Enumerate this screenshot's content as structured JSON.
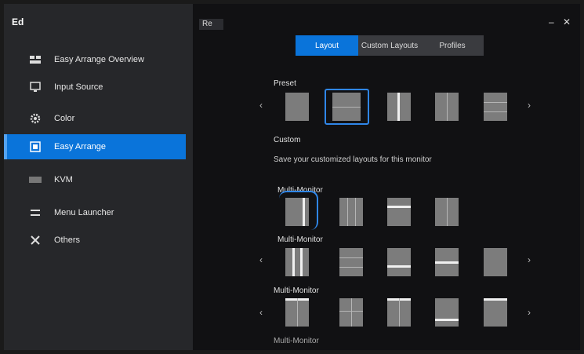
{
  "app": {
    "title": "Ed"
  },
  "window": {
    "minimize": "–",
    "close": "✕"
  },
  "header": {
    "badge": "Re"
  },
  "sidebar": {
    "items": [
      {
        "label": "Easy Arrange Overview",
        "icon": "grid-icon",
        "active": false
      },
      {
        "label": "Input Source",
        "icon": "monitor-icon",
        "active": false
      },
      {
        "label": "Color",
        "icon": "gear-icon",
        "active": false
      },
      {
        "label": "Easy Arrange",
        "icon": "layout-icon",
        "active": true
      },
      {
        "label": "KVM",
        "icon": "keyboard-icon",
        "active": false
      },
      {
        "label": "Menu Launcher",
        "icon": "menu-icon",
        "active": false
      },
      {
        "label": "Others",
        "icon": "tools-icon",
        "active": false
      }
    ]
  },
  "tabs": [
    {
      "label": "Layout",
      "active": true
    },
    {
      "label": "Custom Layouts",
      "active": false
    },
    {
      "label": "Profiles",
      "active": false
    }
  ],
  "sections": {
    "preset": "Preset",
    "custom": "Custom",
    "custom_hint": "Save your customized layouts for this monitor",
    "multi_1": "Multi-Monitor",
    "multi_2": "Multi-Monitor",
    "multi_3": "Multi-Monitor",
    "footer": "Multi-Monitor"
  },
  "nav_arrows": {
    "left": "‹",
    "right": "›"
  }
}
